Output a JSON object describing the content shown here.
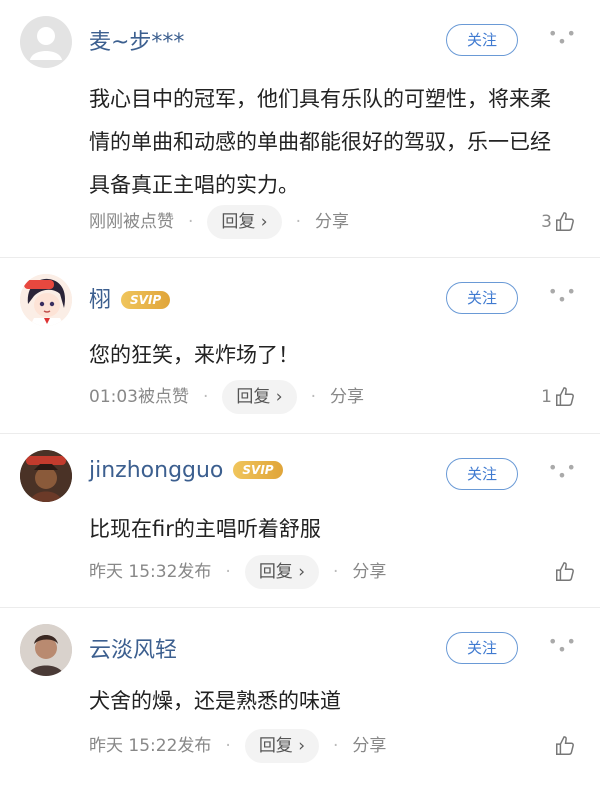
{
  "comments": [
    {
      "username": "麦~步***",
      "badge": "",
      "follow_label": "关注",
      "content": "我心目中的冠军，他们具有乐队的可塑性，将来柔情的单曲和动感的单曲都能很好的驾驭，乐一已经具备真正主唱的实力。",
      "time_status": "刚刚被点赞",
      "reply_label": "回复",
      "share_label": "分享",
      "like_count": "3",
      "avatar_icon": "default-avatar-icon"
    },
    {
      "username": "栩",
      "badge": "SVIP",
      "follow_label": "关注",
      "content": "您的狂笑，来炸场了！",
      "time_status": "01:03被点赞",
      "reply_label": "回复",
      "share_label": "分享",
      "like_count": "1",
      "avatar_icon": "anime-girl-avatar"
    },
    {
      "username": "jinzhongguo",
      "badge": "SVIP",
      "follow_label": "关注",
      "content": "比现在fir的主唱听着舒服",
      "time_status": "昨天 15:32发布",
      "reply_label": "回复",
      "share_label": "分享",
      "like_count": "",
      "avatar_icon": "warrior-avatar"
    },
    {
      "username": "云淡风轻",
      "badge": "",
      "follow_label": "关注",
      "content": "犬舍的燥，还是熟悉的味道",
      "time_status": "昨天 15:22发布",
      "reply_label": "回复",
      "share_label": "分享",
      "like_count": "",
      "avatar_icon": "photo-avatar"
    }
  ],
  "colors": {
    "username": "#3c5f8f",
    "follow_border": "#6a9ad6",
    "svip_gold": "#e8b34a",
    "meta_gray": "#888888"
  }
}
